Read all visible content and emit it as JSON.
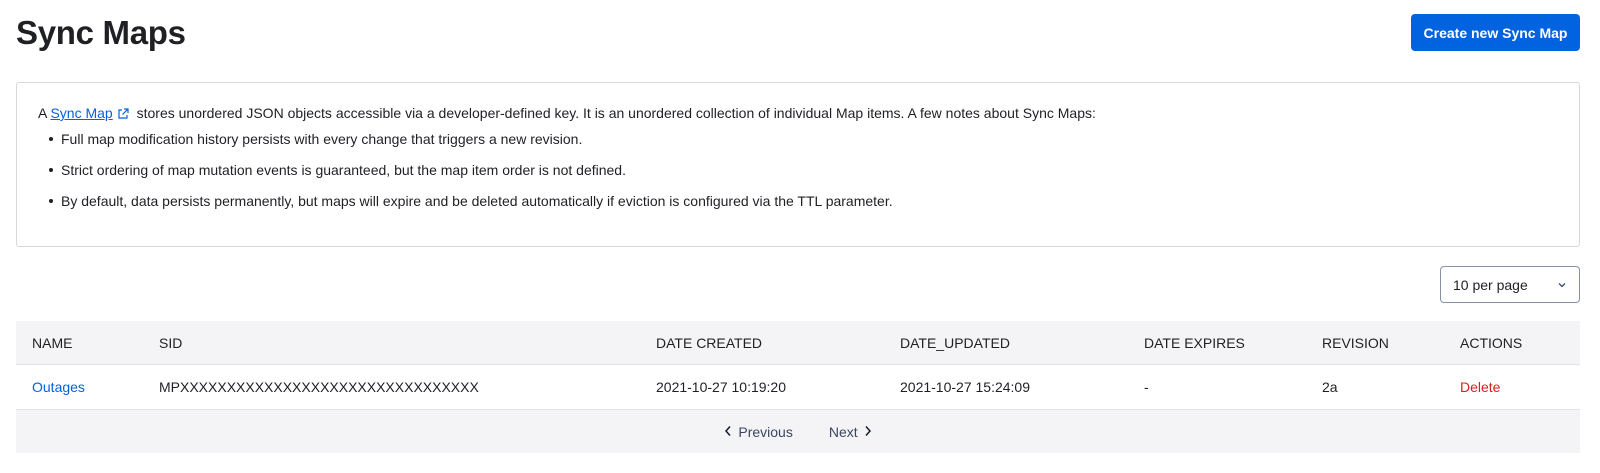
{
  "header": {
    "title": "Sync Maps",
    "create_label": "Create new Sync Map"
  },
  "info": {
    "intro_prefix": "A",
    "link_text": "Sync Map",
    "intro_suffix": "stores unordered JSON objects accessible via a developer-defined key. It is an unordered collection of individual Map items. A few notes about Sync Maps:",
    "notes": [
      "Full map modification history persists with every change that triggers a new revision.",
      "Strict ordering of map mutation events is guaranteed, but the map item order is not defined.",
      "By default, data persists permanently, but maps will expire and be deleted automatically if eviction is configured via the TTL parameter."
    ]
  },
  "pagination": {
    "per_page": "10 per page",
    "previous": "Previous",
    "next": "Next"
  },
  "table": {
    "columns": [
      "NAME",
      "SID",
      "DATE CREATED",
      "DATE_UPDATED",
      "DATE EXPIRES",
      "REVISION",
      "ACTIONS"
    ],
    "rows": [
      {
        "name": "Outages",
        "sid": "MPXXXXXXXXXXXXXXXXXXXXXXXXXXXXXXXX",
        "date_created": "2021-10-27 10:19:20",
        "date_updated": "2021-10-27 15:24:09",
        "date_expires": "-",
        "revision": "2a",
        "action": "Delete"
      }
    ]
  },
  "colors": {
    "primary": "#0263e0",
    "danger": "#d61f1f",
    "header_bg": "#f4f4f6"
  }
}
